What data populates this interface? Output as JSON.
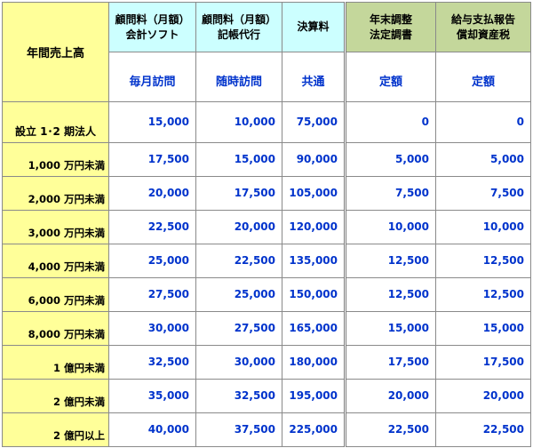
{
  "table": {
    "corner_label": "年間売上高",
    "columns": [
      {
        "line1": "顧問料（月額）",
        "line2": "会計ソフト",
        "sub": "毎月訪問",
        "group": "monthly"
      },
      {
        "line1": "顧問料（月額）",
        "line2": "記帳代行",
        "sub": "随時訪問",
        "group": "monthly"
      },
      {
        "line1": "決算料",
        "line2": "",
        "sub": "共通",
        "group": "monthly"
      },
      {
        "line1": "年末調整",
        "line2": "法定調書",
        "sub": "定額",
        "group": "annual"
      },
      {
        "line1": "給与支払報告",
        "line2": "償却資産税",
        "sub": "定額",
        "group": "annual"
      }
    ],
    "rows": [
      {
        "label": "設立 1･2 期法人",
        "values": [
          "15,000",
          "10,000",
          "75,000",
          "0",
          "0"
        ]
      },
      {
        "label": "1,000 万円未満",
        "values": [
          "17,500",
          "15,000",
          "90,000",
          "5,000",
          "5,000"
        ]
      },
      {
        "label": "2,000 万円未満",
        "values": [
          "20,000",
          "17,500",
          "105,000",
          "7,500",
          "7,500"
        ]
      },
      {
        "label": "3,000 万円未満",
        "values": [
          "22,500",
          "20,000",
          "120,000",
          "10,000",
          "10,000"
        ]
      },
      {
        "label": "4,000 万円未満",
        "values": [
          "25,000",
          "22,500",
          "135,000",
          "12,500",
          "12,500"
        ]
      },
      {
        "label": "6,000 万円未満",
        "values": [
          "27,500",
          "25,000",
          "150,000",
          "12,500",
          "12,500"
        ]
      },
      {
        "label": "8,000 万円未満",
        "values": [
          "30,000",
          "27,500",
          "165,000",
          "15,000",
          "15,000"
        ]
      },
      {
        "label": "1 億円未満",
        "values": [
          "32,500",
          "30,000",
          "180,000",
          "17,500",
          "17,500"
        ]
      },
      {
        "label": "2 億円未満",
        "values": [
          "35,000",
          "32,500",
          "195,000",
          "20,000",
          "20,000"
        ]
      },
      {
        "label": "2 億円以上",
        "values": [
          "40,000",
          "37,500",
          "225,000",
          "22,500",
          "22,500"
        ]
      }
    ]
  }
}
